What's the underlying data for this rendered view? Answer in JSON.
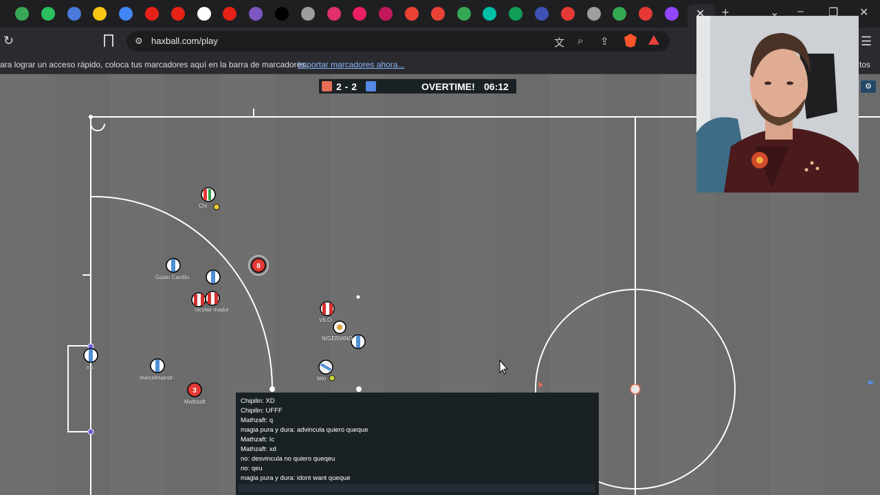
{
  "browser": {
    "url": "haxball.com/play",
    "bookmarks_bar_text": "ara lograr un acceso rápido, coloca tus marcadores aquí en la barra de marcadores.",
    "bookmarks_import_link": "Importar marcadores ahora...",
    "bookmarks_right_text": "tos",
    "tab_favicon_colors": [
      "#3aa757",
      "#2bbf5f",
      "#4a7bdc",
      "#f9c513",
      "#4285f4",
      "#e62117",
      "#e62117",
      "#ffffff",
      "#e62117",
      "#7e57c2",
      "#000000",
      "#9e9e9e",
      "#e1306c",
      "#e91e63",
      "#c2185b",
      "#ea4335",
      "#ea4335",
      "#34a853",
      "#00bfa5",
      "#0f9d58",
      "#3f51b5",
      "#e53935",
      "#9e9e9e",
      "#34a853",
      "#e53935",
      "#9146ff",
      "#808080"
    ]
  },
  "game": {
    "score_red": "2",
    "score_sep": "-",
    "score_blue": "2",
    "score_text": "2 - 2",
    "status": "OVERTIME!",
    "time": "06:12",
    "colors": {
      "red_team": "#e56e56",
      "blue_team": "#5689e5",
      "pitch": "#6e6e6e",
      "lines": "#ffffff"
    },
    "players": [
      {
        "name": "Chi",
        "team": "red"
      },
      {
        "name": "Guido Carrillo",
        "team": "blue"
      },
      {
        "name": "nicolas madur",
        "team": "red"
      },
      {
        "name": "no",
        "team": "blue"
      },
      {
        "name": "marcelmaestr",
        "team": "blue"
      },
      {
        "name": "Mathzaft",
        "team": "red"
      },
      {
        "name": "VILO",
        "team": "red"
      },
      {
        "name": "NIGERIANO",
        "team": "blue"
      },
      {
        "name": "teto",
        "team": "blue"
      }
    ],
    "player_numbers": {
      "mathzaft": "3",
      "center_red": "8"
    }
  },
  "chat": {
    "messages": [
      "Chipilin: XD",
      "Chipilin: UFFF",
      "Mathzaft: q",
      "magia pura y dura: advincula quiero queque",
      "Mathzaft: Ic",
      "Mathzaft: xd",
      "no: desvincula no quiero queqeu",
      "no: qeu",
      "magia pura y dura: idont want queque"
    ]
  }
}
